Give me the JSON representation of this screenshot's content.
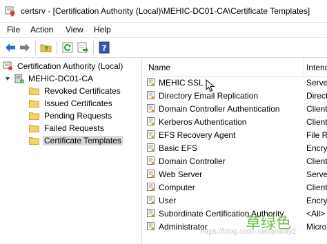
{
  "window": {
    "title": "certsrv - [Certification Authority (Local)\\MEHIC-DC01-CA\\Certificate Templates]",
    "icon": "certsrv-icon"
  },
  "menu": [
    "File",
    "Action",
    "View",
    "Help"
  ],
  "toolbar": {
    "buttons": [
      "back-arrow-icon",
      "forward-arrow-icon",
      "up-folder-icon",
      "refresh-icon",
      "export-list-icon",
      "help-icon"
    ]
  },
  "tree": {
    "root": "Certification Authority (Local)",
    "ca": "MEHIC-DC01-CA",
    "folders": [
      "Revoked Certificates",
      "Issued Certificates",
      "Pending Requests",
      "Failed Requests",
      "Certificate Templates"
    ],
    "selected_index": 4
  },
  "list": {
    "columns": [
      "Name",
      "Intende"
    ],
    "rows": [
      {
        "name": "MEHIC SSL",
        "purpose": "Serve"
      },
      {
        "name": "Directory Email Replication",
        "purpose": "Direct"
      },
      {
        "name": "Domain Controller Authentication",
        "purpose": "Client"
      },
      {
        "name": "Kerberos Authentication",
        "purpose": "Client"
      },
      {
        "name": "EFS Recovery Agent",
        "purpose": "File R"
      },
      {
        "name": "Basic EFS",
        "purpose": "Encry"
      },
      {
        "name": "Domain Controller",
        "purpose": "Client"
      },
      {
        "name": "Web Server",
        "purpose": "Serve"
      },
      {
        "name": "Computer",
        "purpose": "Client"
      },
      {
        "name": "User",
        "purpose": "Encry"
      },
      {
        "name": "Subordinate Certification Authority",
        "purpose": "<All>"
      },
      {
        "name": "Administrator",
        "purpose": "Micro"
      }
    ]
  },
  "watermark": {
    "url": "https://blog.csdn.net/anway2",
    "text": "草绿色"
  }
}
